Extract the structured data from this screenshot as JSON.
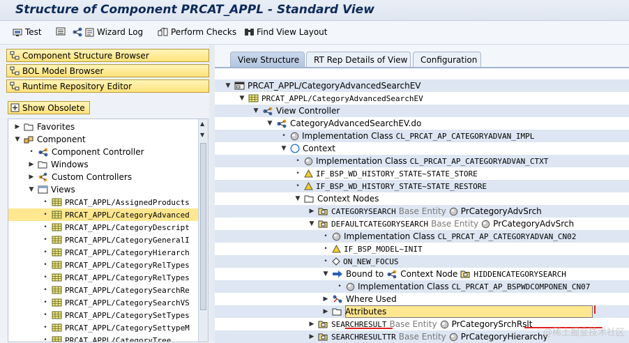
{
  "title": "Structure of Component PRCAT_APPL - Standard View",
  "toolbar": {
    "test": "Test",
    "wizard_log": "Wizard Log",
    "perform_checks": "Perform Checks",
    "find_view_layout": "Find View Layout"
  },
  "nav_buttons": [
    "Component Structure Browser",
    "BOL Model Browser",
    "Runtime Repository Editor"
  ],
  "show_obsolete": "Show Obsolete",
  "left_tree": [
    {
      "level": 0,
      "toggle": "▶",
      "icon": "folder",
      "text": "Favorites"
    },
    {
      "level": 0,
      "toggle": "▼",
      "icon": "component",
      "text": "Component"
    },
    {
      "level": 1,
      "toggle": "•",
      "icon": "controller",
      "text": "Component Controller"
    },
    {
      "level": 1,
      "toggle": "▶",
      "icon": "folder",
      "text": "Windows"
    },
    {
      "level": 1,
      "toggle": "▶",
      "icon": "controllers",
      "text": "Custom Controllers"
    },
    {
      "level": 1,
      "toggle": "▼",
      "icon": "views",
      "text": "Views"
    },
    {
      "level": 2,
      "toggle": "•",
      "icon": "view",
      "text": "PRCAT_APPL/AssignedProducts"
    },
    {
      "level": 2,
      "toggle": "•",
      "icon": "view",
      "text": "PRCAT_APPL/CategoryAdvanced"
    },
    {
      "level": 2,
      "toggle": "•",
      "icon": "view",
      "text": "PRCAT_APPL/CategoryDescript"
    },
    {
      "level": 2,
      "toggle": "•",
      "icon": "view",
      "text": "PRCAT_APPL/CategoryGeneralI"
    },
    {
      "level": 2,
      "toggle": "•",
      "icon": "view",
      "text": "PRCAT_APPL/CategoryHierarch"
    },
    {
      "level": 2,
      "toggle": "•",
      "icon": "view",
      "text": "PRCAT_APPL/CategoryRelTypes"
    },
    {
      "level": 2,
      "toggle": "•",
      "icon": "view",
      "text": "PRCAT_APPL/CategoryRelTypes"
    },
    {
      "level": 2,
      "toggle": "•",
      "icon": "view",
      "text": "PRCAT_APPL/CategorySearchRe"
    },
    {
      "level": 2,
      "toggle": "•",
      "icon": "view",
      "text": "PRCAT_APPL/CategorySearchVS"
    },
    {
      "level": 2,
      "toggle": "•",
      "icon": "view",
      "text": "PRCAT_APPL/CategorySetTypes"
    },
    {
      "level": 2,
      "toggle": "•",
      "icon": "view",
      "text": "PRCAT_APPL/CategorySettypeM"
    },
    {
      "level": 2,
      "toggle": "•",
      "icon": "view",
      "text": "PRCAT_APPL/CategoryTree"
    }
  ],
  "tabs": [
    "View Structure",
    "RT Rep Details of View",
    "Configuration"
  ],
  "right_tree": [
    {
      "level": 0,
      "toggle": "▼",
      "icon": "window",
      "segs": [
        {
          "t": "PRCAT_APPL/CategoryAdvancedSearchEV"
        }
      ]
    },
    {
      "level": 1,
      "toggle": "▼",
      "icon": "view",
      "segs": [
        {
          "t": "PRCAT_APPL/CategoryAdvancedSearchEV",
          "m": true
        }
      ]
    },
    {
      "level": 2,
      "toggle": "▼",
      "icon": "controller",
      "segs": [
        {
          "t": "View Controller"
        }
      ]
    },
    {
      "level": 3,
      "toggle": "▼",
      "icon": "controller",
      "segs": [
        {
          "t": "CategoryAdvancedSearchEV.do"
        }
      ]
    },
    {
      "level": 4,
      "toggle": "•",
      "icon": "class",
      "segs": [
        {
          "t": "Implementation Class"
        },
        {
          "t": "CL_PRCAT_AP_CATEGORYADVAN_IMPL",
          "m": true
        }
      ]
    },
    {
      "level": 4,
      "toggle": "▼",
      "icon": "context",
      "segs": [
        {
          "t": "Context"
        }
      ]
    },
    {
      "level": 5,
      "toggle": "•",
      "icon": "class",
      "segs": [
        {
          "t": "Implementation Class"
        },
        {
          "t": "CL_PRCAT_AP_CATEGORYADVAN_CTXT",
          "m": true
        }
      ]
    },
    {
      "level": 5,
      "toggle": "•",
      "icon": "warning",
      "segs": [
        {
          "t": "IF_BSP_WD_HISTORY_STATE~STATE_STORE",
          "m": true
        }
      ]
    },
    {
      "level": 5,
      "toggle": "•",
      "icon": "warning",
      "segs": [
        {
          "t": "IF_BSP_WD_HISTORY_STATE~STATE_RESTORE",
          "m": true
        }
      ]
    },
    {
      "level": 5,
      "toggle": "▼",
      "icon": "folder",
      "segs": [
        {
          "t": "Context Nodes"
        }
      ]
    },
    {
      "level": 6,
      "toggle": "▶",
      "icon": "node",
      "segs": [
        {
          "t": "CATEGORYSEARCH",
          "m": true
        },
        {
          "t": "Base Entity",
          "g": true
        },
        {
          "t": "PrCategoryAdvSrch",
          "ic": "class"
        }
      ]
    },
    {
      "level": 6,
      "toggle": "▼",
      "icon": "node",
      "segs": [
        {
          "t": "DEFAULTCATEGORYSEARCH",
          "m": true
        },
        {
          "t": "Base Entity",
          "g": true
        },
        {
          "t": "PrCategoryAdvSrch",
          "ic": "class"
        }
      ]
    },
    {
      "level": 7,
      "toggle": "•",
      "icon": "class",
      "segs": [
        {
          "t": "Implementation Class"
        },
        {
          "t": "CL_PRCAT_AP_CATEGORYADVAN_CN02",
          "m": true
        }
      ]
    },
    {
      "level": 7,
      "toggle": "•",
      "icon": "warning",
      "segs": [
        {
          "t": "IF_BSP_MODEL~INIT",
          "m": true
        }
      ]
    },
    {
      "level": 7,
      "toggle": "•",
      "icon": "diamond",
      "segs": [
        {
          "t": "ON_NEW_FOCUS",
          "m": true
        }
      ]
    },
    {
      "level": 7,
      "toggle": "▼",
      "icon": "arrow",
      "segs": [
        {
          "t": "Bound to"
        },
        {
          "t": "Context Node",
          "ic": "controller"
        },
        {
          "t": "HIDDENCATEGORYSEARCH",
          "m": true,
          "ic": "node"
        }
      ]
    },
    {
      "level": 8,
      "toggle": "•",
      "icon": "class",
      "segs": [
        {
          "t": "Implementation Class"
        },
        {
          "t": "CL_PRCAT_AP_BSPWDCOMPONEN_CN07",
          "m": true
        }
      ]
    },
    {
      "level": 7,
      "toggle": "▶",
      "icon": "whereused",
      "segs": [
        {
          "t": "Where Used"
        }
      ]
    },
    {
      "level": 7,
      "toggle": "▶",
      "icon": "folder",
      "segs": [
        {
          "t": "Attributes"
        }
      ]
    },
    {
      "level": 6,
      "toggle": "▶",
      "icon": "node",
      "segs": [
        {
          "t": "SEARCHRESULT",
          "m": true
        },
        {
          "t": "Base Entity",
          "g": true
        },
        {
          "t": "PrCategorySrchRslt",
          "ic": "class"
        }
      ]
    },
    {
      "level": 6,
      "toggle": "▶",
      "icon": "node",
      "segs": [
        {
          "t": "SEARCHRESULTTR",
          "m": true
        },
        {
          "t": "Base Entity",
          "g": true
        },
        {
          "t": "PrCategoryHierarchy",
          "ic": "class"
        }
      ]
    }
  ],
  "watermark": "@稀土掘金技术社区",
  "colors": {
    "selection": "#ffe790",
    "nav_button": "#ffe27a",
    "band": "#dde6f2",
    "title": "#0b2a5a"
  }
}
